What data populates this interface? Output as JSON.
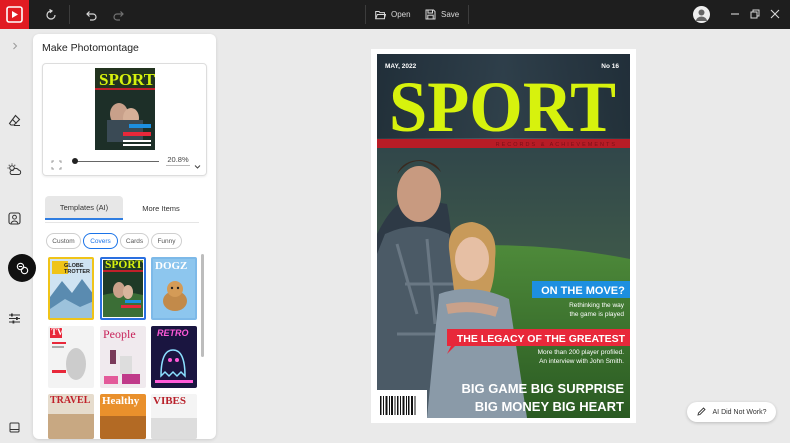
{
  "toolbar": {
    "open_label": "Open",
    "save_label": "Save"
  },
  "panel": {
    "title": "Make Photomontage",
    "zoom": "20.8%",
    "tabs": [
      "Templates (AI)",
      "More Items"
    ],
    "active_tab": "Templates (AI)",
    "filters": [
      "Custom",
      "Covers",
      "Cards",
      "Funny"
    ],
    "active_filter": "Covers",
    "thumbnails": [
      {
        "label": "GLOBE TROTTER"
      },
      {
        "label": "SPORT"
      },
      {
        "label": "DOGZ"
      },
      {
        "label": "TV"
      },
      {
        "label": "People"
      },
      {
        "label": "RETRO"
      },
      {
        "label": "TRAVEL"
      },
      {
        "label": "Healthy"
      },
      {
        "label": "VIBES"
      }
    ]
  },
  "cover": {
    "date": "MAY, 2022",
    "issue": "No 16",
    "masthead": "SPORT",
    "banner": "RECORDS & ACHIEVEMENTS",
    "headline1": "ON THE MOVE?",
    "sub1_line1": "Rethinking the way",
    "sub1_line2": "the game is played",
    "headline2": "THE LEGACY OF THE GREATEST",
    "sub2_line1": "More than 200 player profiled.",
    "sub2_line2": "An interview with John Smith.",
    "bottom_line1": "BIG GAME BIG SURPRISE",
    "bottom_line2": "BIG MONEY BIG HEART"
  },
  "ai_button": {
    "label": "AI Did Not Work?"
  },
  "colors": {
    "brand": "#e11b22",
    "accent_lime": "#d7f20d",
    "blue_box": "#1d8fe0",
    "red_box": "#e8283a",
    "tab_underline": "#2f7de1"
  },
  "icons": [
    "app-logo-icon",
    "redo-rotate-icon",
    "undo-icon",
    "redo-icon",
    "folder-open-icon",
    "save-icon",
    "user-icon",
    "minimize-icon",
    "restore-icon",
    "close-icon",
    "chevron-right-icon",
    "eraser-icon",
    "weather-icon",
    "portrait-icon",
    "photomontage-icon",
    "sliders-icon",
    "gallery-icon",
    "fit-icon",
    "chevron-down-icon",
    "pen-icon"
  ]
}
